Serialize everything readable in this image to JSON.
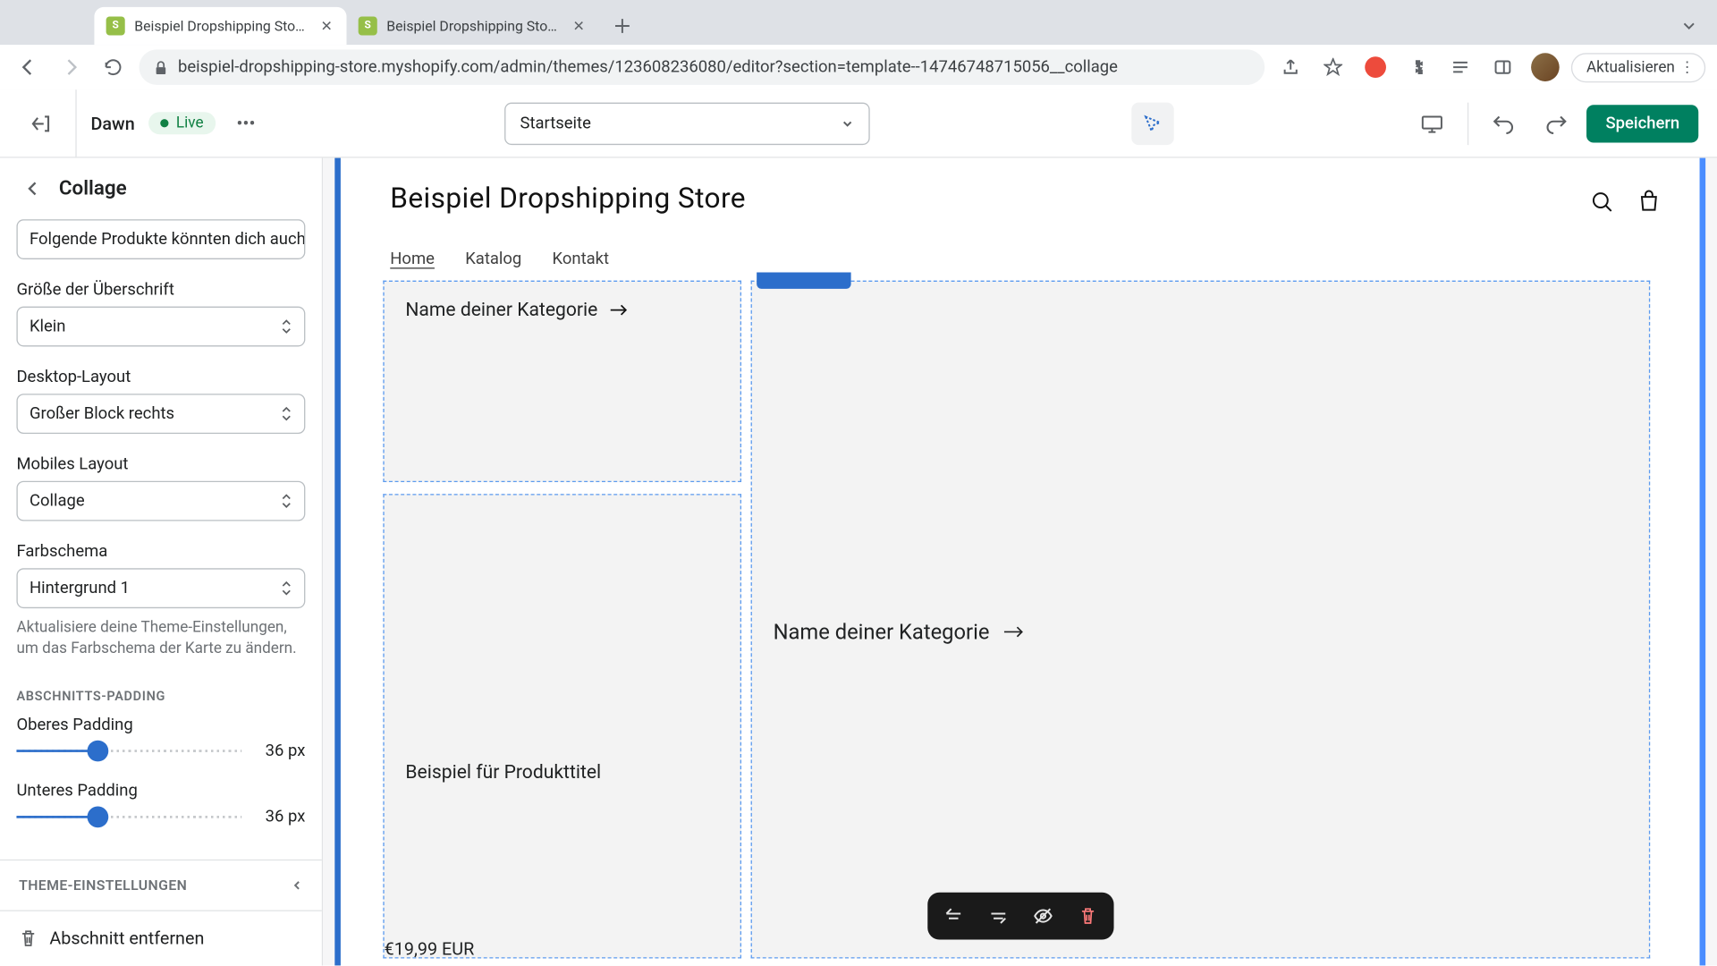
{
  "browser": {
    "tabs": [
      {
        "title": "Beispiel Dropshipping Store · D"
      },
      {
        "title": "Beispiel Dropshipping Store · E"
      }
    ],
    "url": "beispiel-dropshipping-store.myshopify.com/admin/themes/123608236080/editor?section=template--14746748715056__collage",
    "update_label": "Aktualisieren"
  },
  "header": {
    "theme_name": "Dawn",
    "live_label": "Live",
    "page_select": "Startseite",
    "save_label": "Speichern"
  },
  "sidebar": {
    "title": "Collage",
    "text_input": "Folgende Produkte könnten dich auch",
    "fields": {
      "heading_size": {
        "label": "Größe der Überschrift",
        "value": "Klein"
      },
      "desktop_layout": {
        "label": "Desktop-Layout",
        "value": "Großer Block rechts"
      },
      "mobile_layout": {
        "label": "Mobiles Layout",
        "value": "Collage"
      },
      "color_scheme": {
        "label": "Farbschema",
        "value": "Hintergrund 1",
        "hint": "Aktualisiere deine Theme-Einstellungen, um das Farbschema der Karte zu ändern."
      }
    },
    "padding_section": "ABSCHNITTS-PADDING",
    "padding_top": {
      "label": "Oberes Padding",
      "value": "36 px",
      "percent": 36
    },
    "padding_bottom": {
      "label": "Unteres Padding",
      "value": "36 px",
      "percent": 36
    },
    "theme_settings": "THEME-EINSTELLUNGEN",
    "remove_section": "Abschnitt entfernen"
  },
  "preview": {
    "store_title": "Beispiel Dropshipping Store",
    "nav": {
      "home": "Home",
      "katalog": "Katalog",
      "kontakt": "Kontakt"
    },
    "category_label": "Name deiner Kategorie",
    "product_title": "Beispiel für Produkttitel",
    "product_price": "€19,99 EUR"
  }
}
